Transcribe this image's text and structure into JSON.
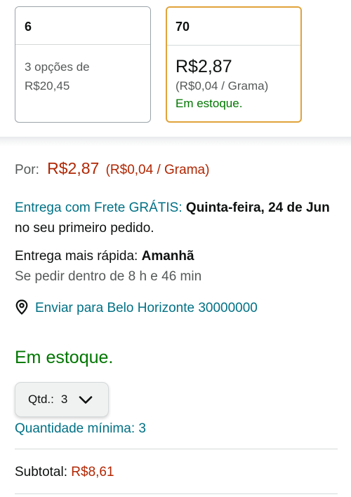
{
  "options": [
    {
      "header": "6",
      "text": "3 opções de R$20,45",
      "selected": false
    },
    {
      "header": "70",
      "price": "R$2,87",
      "unit_price": "(R$0,04 / Grama)",
      "stock": "Em estoque.",
      "selected": true
    }
  ],
  "price_row": {
    "label": "Por:",
    "price": "R$2,87",
    "unit_price": "(R$0,04 / Grama)"
  },
  "delivery": {
    "free_label": "Entrega com Frete GRÁTIS:",
    "date": "Quinta-feira, 24 de Jun",
    "suffix": "no seu primeiro pedido."
  },
  "fast_delivery": {
    "label": "Entrega mais rápida:",
    "day": "Amanhã",
    "countdown": "Se pedir dentro de 8 h e 46 min"
  },
  "ship_to": {
    "icon": "location-pin-icon",
    "text": "Enviar para Belo Horizonte 30000000"
  },
  "availability": "Em estoque.",
  "quantity": {
    "label": "Qtd.:",
    "value": "3",
    "icon": "chevron-down-icon"
  },
  "min_quantity": "Quantidade mínima: 3",
  "subtotal": {
    "label": "Subtotal:",
    "value": "R$8,61"
  },
  "colors": {
    "price": "#b12704",
    "link": "#007185",
    "stock": "#007600",
    "selected_border": "#e0a33a"
  }
}
